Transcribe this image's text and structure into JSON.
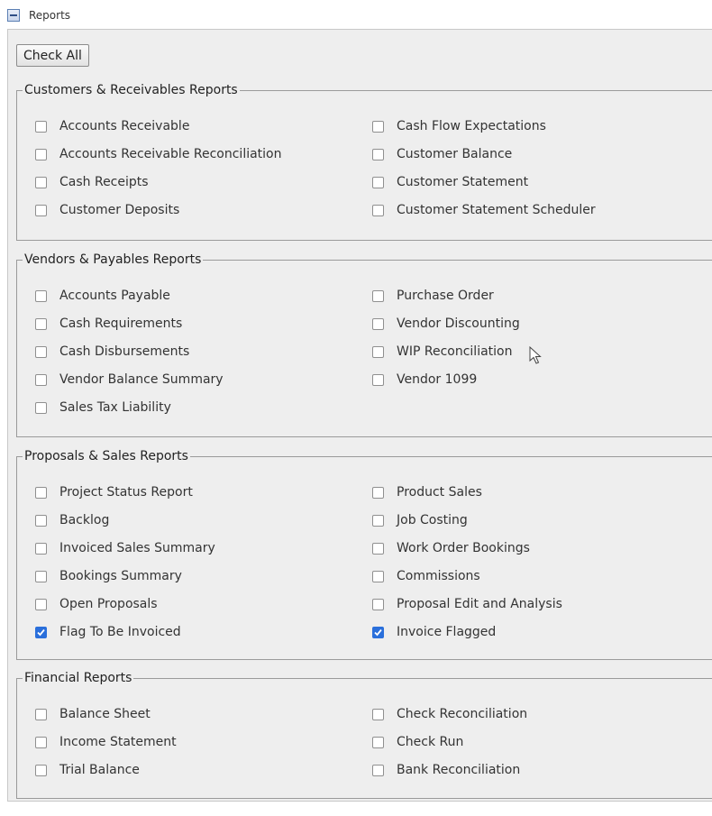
{
  "header": {
    "title": "Reports"
  },
  "check_all_label": "Check All",
  "groups": [
    {
      "legend": "Customers & Receivables Reports",
      "left": [
        {
          "label": "Accounts Receivable",
          "checked": false
        },
        {
          "label": "Accounts Receivable Reconciliation",
          "checked": false
        },
        {
          "label": "Cash Receipts",
          "checked": false
        },
        {
          "label": "Customer Deposits",
          "checked": false
        }
      ],
      "right": [
        {
          "label": "Cash Flow Expectations",
          "checked": false
        },
        {
          "label": "Customer Balance",
          "checked": false
        },
        {
          "label": "Customer Statement",
          "checked": false
        },
        {
          "label": "Customer Statement Scheduler",
          "checked": false
        }
      ]
    },
    {
      "legend": "Vendors & Payables Reports",
      "left": [
        {
          "label": "Accounts Payable",
          "checked": false
        },
        {
          "label": "Cash Requirements",
          "checked": false
        },
        {
          "label": "Cash Disbursements",
          "checked": false
        },
        {
          "label": "Vendor Balance Summary",
          "checked": false
        },
        {
          "label": "Sales Tax Liability",
          "checked": false
        }
      ],
      "right": [
        {
          "label": "Purchase Order",
          "checked": false
        },
        {
          "label": "Vendor Discounting",
          "checked": false
        },
        {
          "label": "WIP Reconciliation",
          "checked": false
        },
        {
          "label": "Vendor 1099",
          "checked": false
        }
      ]
    },
    {
      "legend": "Proposals & Sales Reports",
      "left": [
        {
          "label": "Project Status Report",
          "checked": false
        },
        {
          "label": "Backlog",
          "checked": false
        },
        {
          "label": "Invoiced Sales Summary",
          "checked": false
        },
        {
          "label": "Bookings Summary",
          "checked": false
        },
        {
          "label": "Open Proposals",
          "checked": false
        },
        {
          "label": "Flag To Be Invoiced",
          "checked": true
        }
      ],
      "right": [
        {
          "label": "Product Sales",
          "checked": false
        },
        {
          "label": "Job Costing",
          "checked": false
        },
        {
          "label": "Work Order Bookings",
          "checked": false
        },
        {
          "label": "Commissions",
          "checked": false
        },
        {
          "label": "Proposal Edit and Analysis",
          "checked": false
        },
        {
          "label": "Invoice Flagged",
          "checked": true
        }
      ]
    },
    {
      "legend": "Financial Reports",
      "left": [
        {
          "label": "Balance Sheet",
          "checked": false
        },
        {
          "label": "Income Statement",
          "checked": false
        },
        {
          "label": "Trial Balance",
          "checked": false
        }
      ],
      "right": [
        {
          "label": "Check Reconciliation",
          "checked": false
        },
        {
          "label": "Check Run",
          "checked": false
        },
        {
          "label": "Bank Reconciliation",
          "checked": false
        }
      ]
    }
  ],
  "colors": {
    "panel_bg": "#eeeeee",
    "checkbox_checked": "#2a6fdb"
  }
}
